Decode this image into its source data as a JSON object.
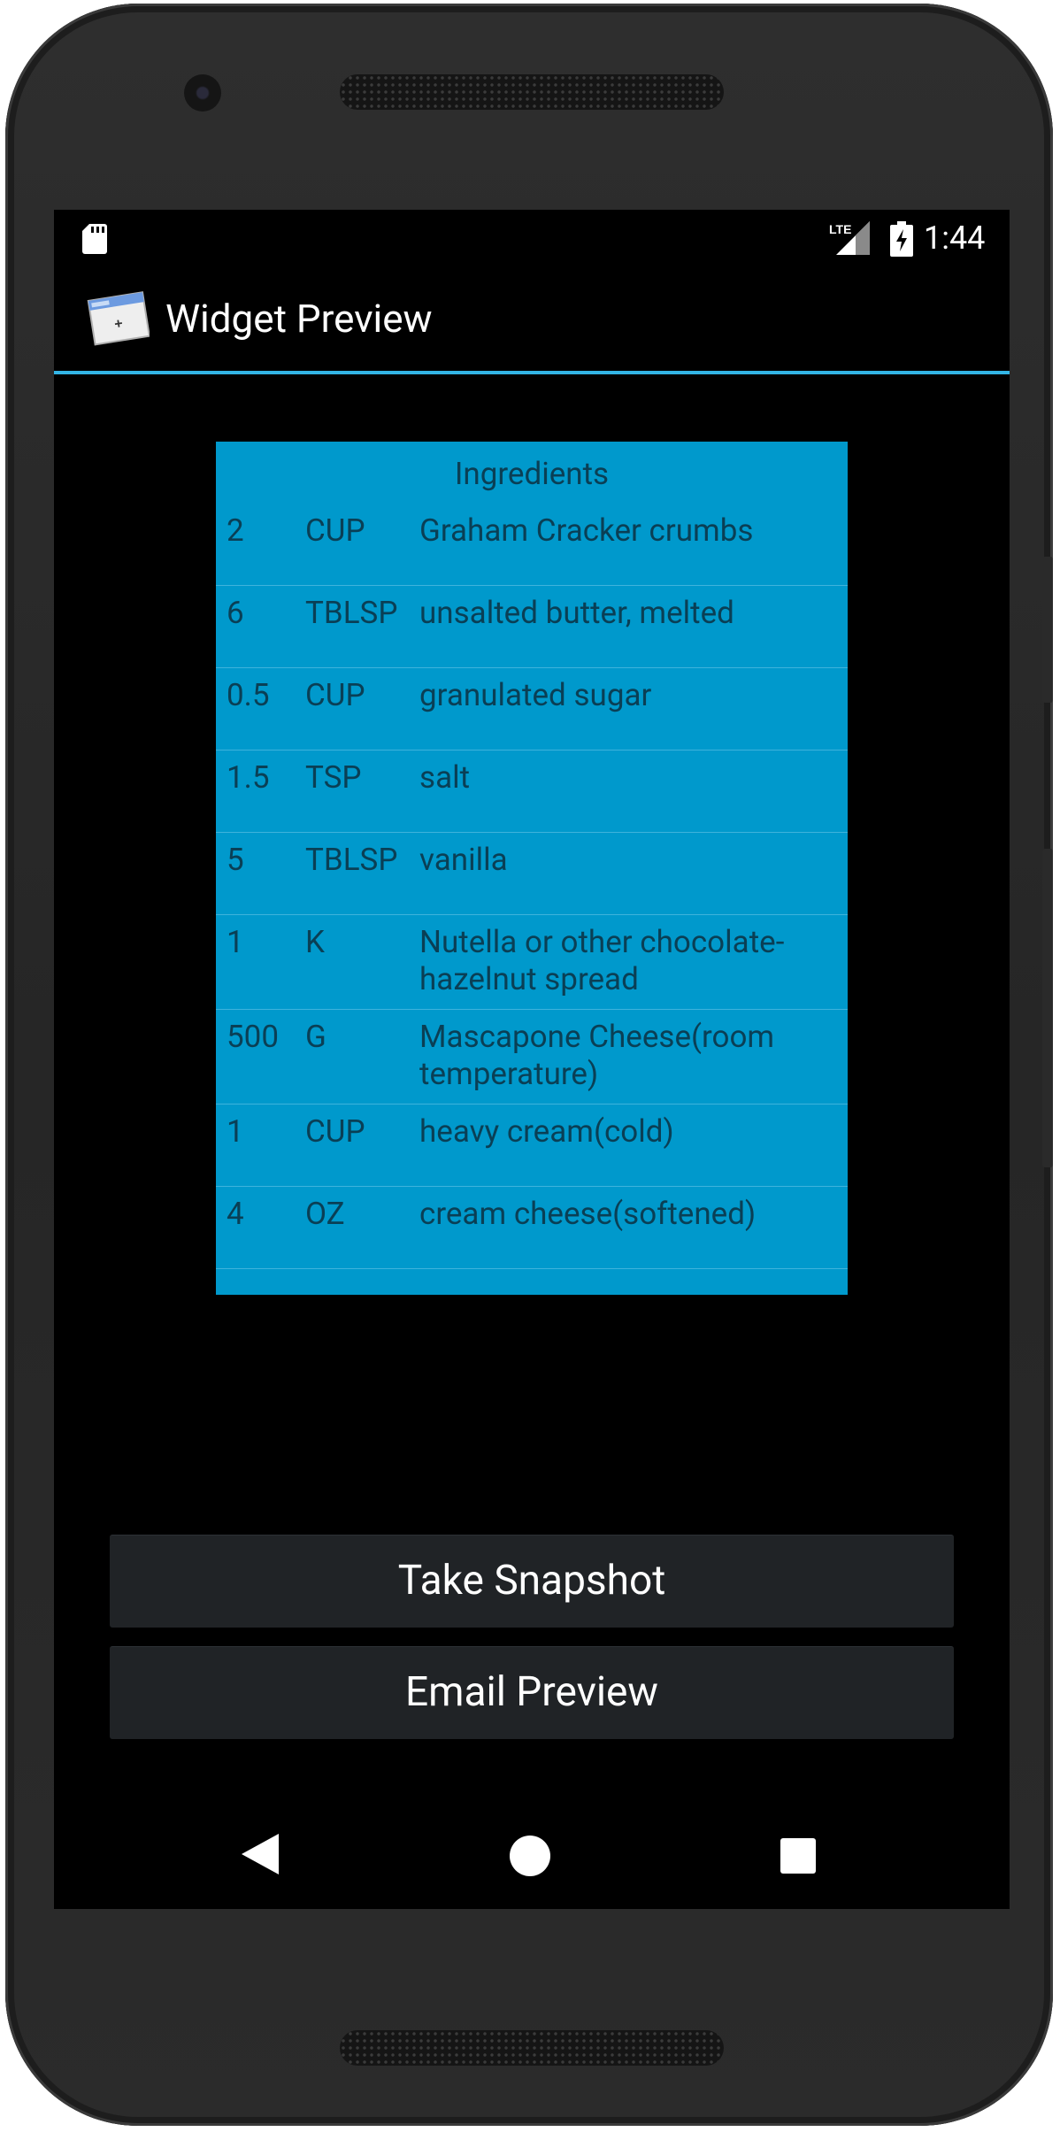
{
  "status_bar": {
    "time": "1:44",
    "network_label": "LTE"
  },
  "app": {
    "title": "Widget Preview",
    "accent_color": "#33b5e5"
  },
  "widget": {
    "background_color": "#0099cc",
    "title": "Ingredients",
    "ingredients": [
      {
        "qty": "2",
        "unit": "CUP",
        "name": "Graham Cracker crumbs"
      },
      {
        "qty": "6",
        "unit": "TBLSP",
        "name": "unsalted butter, melted"
      },
      {
        "qty": "0.5",
        "unit": "CUP",
        "name": "granulated sugar"
      },
      {
        "qty": "1.5",
        "unit": "TSP",
        "name": "salt"
      },
      {
        "qty": "5",
        "unit": "TBLSP",
        "name": "vanilla"
      },
      {
        "qty": "1",
        "unit": "K",
        "name": "Nutella or other chocolate-hazelnut spread"
      },
      {
        "qty": "500",
        "unit": "G",
        "name": "Mascapone Cheese(room temperature)"
      },
      {
        "qty": "1",
        "unit": "CUP",
        "name": "heavy cream(cold)"
      },
      {
        "qty": "4",
        "unit": "OZ",
        "name": "cream cheese(softened)"
      }
    ]
  },
  "buttons": {
    "snapshot_label": "Take Snapshot",
    "email_label": "Email Preview"
  },
  "nav_icons": [
    "back-icon",
    "home-icon",
    "recent-apps-icon"
  ]
}
